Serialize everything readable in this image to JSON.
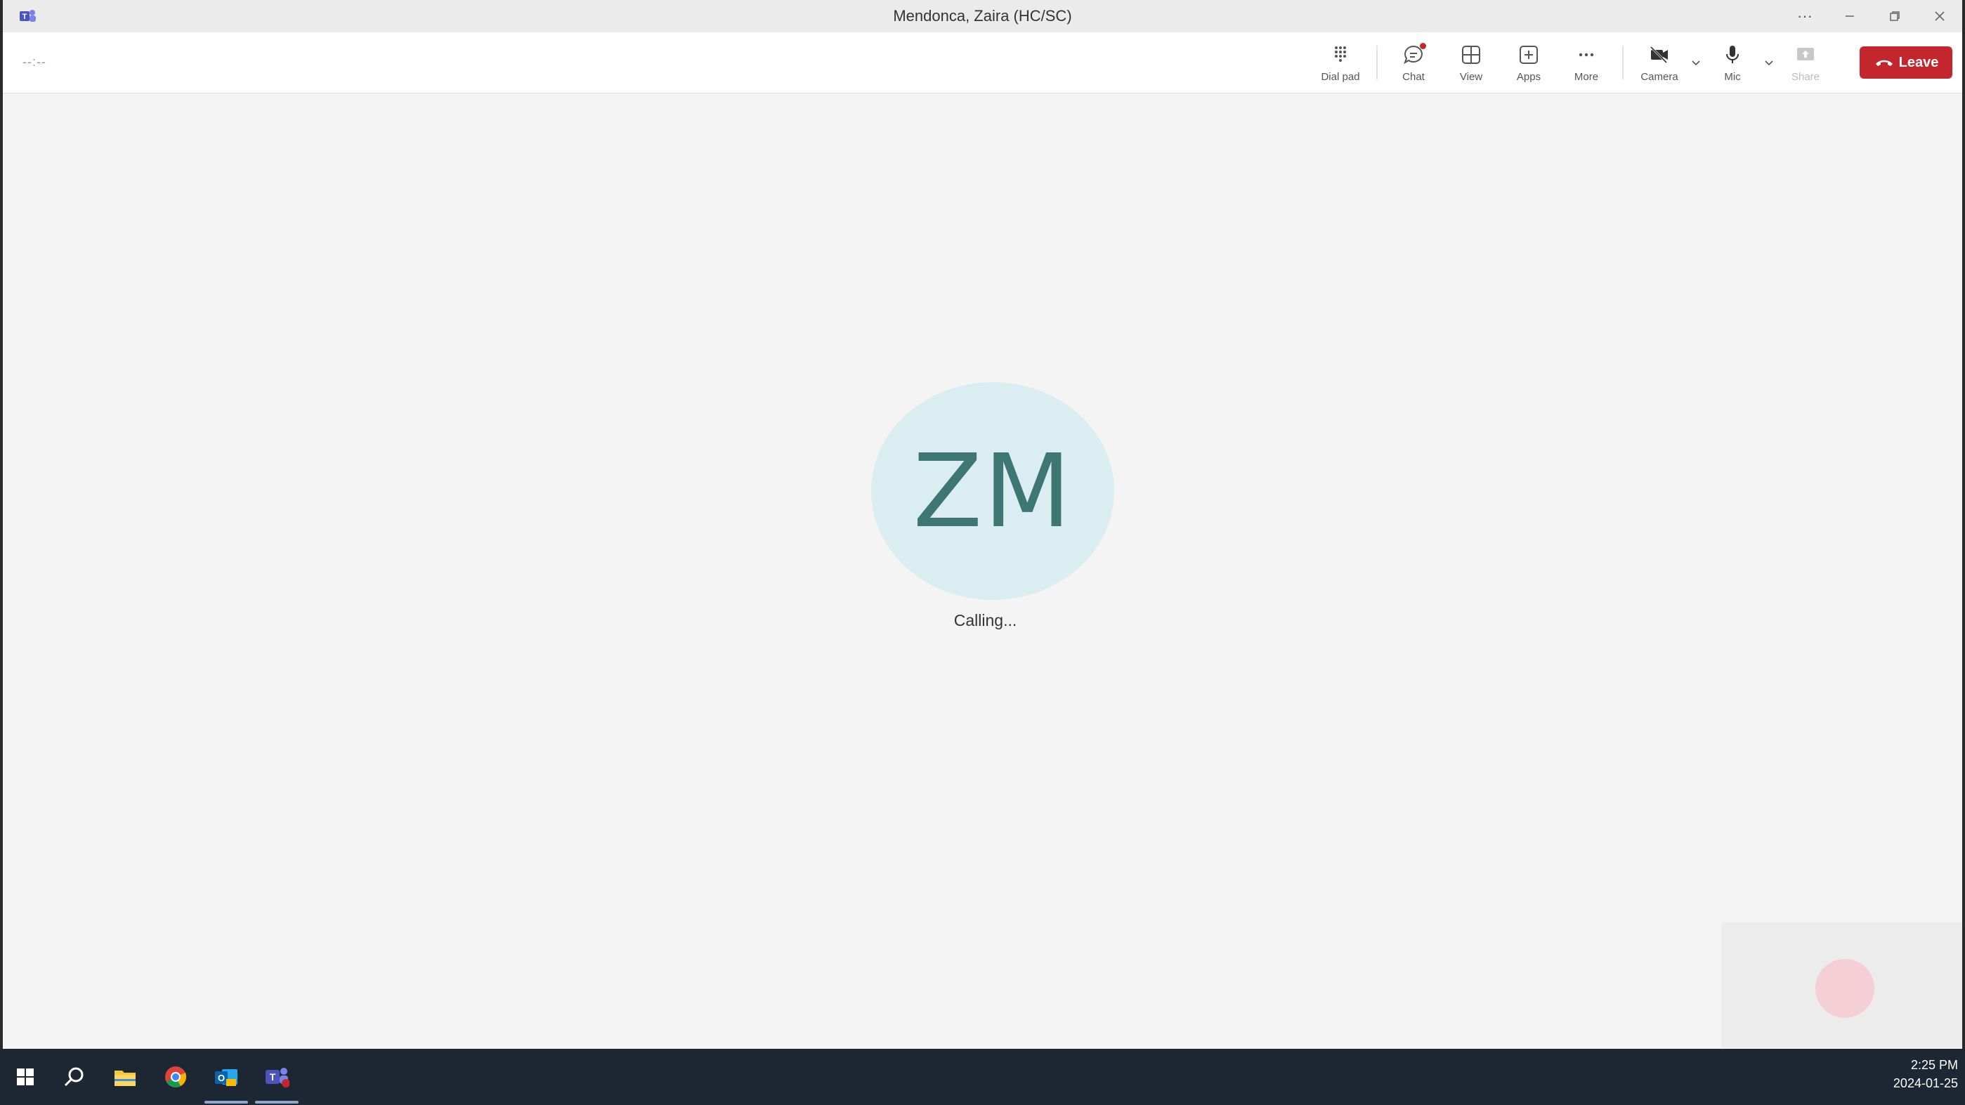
{
  "window": {
    "title": "Mendonca, Zaira (HC/SC)",
    "app_icon": "teams-icon",
    "controls": [
      "more-icon",
      "minimize-icon",
      "restore-icon",
      "close-icon"
    ]
  },
  "toolbar": {
    "timer": "--:--",
    "tools": {
      "dialpad": "Dial pad",
      "chat": "Chat",
      "view": "View",
      "apps": "Apps",
      "more": "More",
      "camera": "Camera",
      "mic": "Mic",
      "share": "Share"
    },
    "leave_label": "Leave",
    "leave_color": "#c4262e",
    "chat_notification_color": "#c4262e"
  },
  "call": {
    "initials": "ZM",
    "status": "Calling...",
    "avatar_bg": "#daeef2",
    "initials_color": "#3e7674"
  },
  "taskbar": {
    "apps": [
      "windows-start-icon",
      "search-icon",
      "file-explorer-icon",
      "chrome-icon",
      "outlook-icon",
      "teams-icon"
    ],
    "time": "2:25 PM",
    "date": "2024-01-25"
  }
}
